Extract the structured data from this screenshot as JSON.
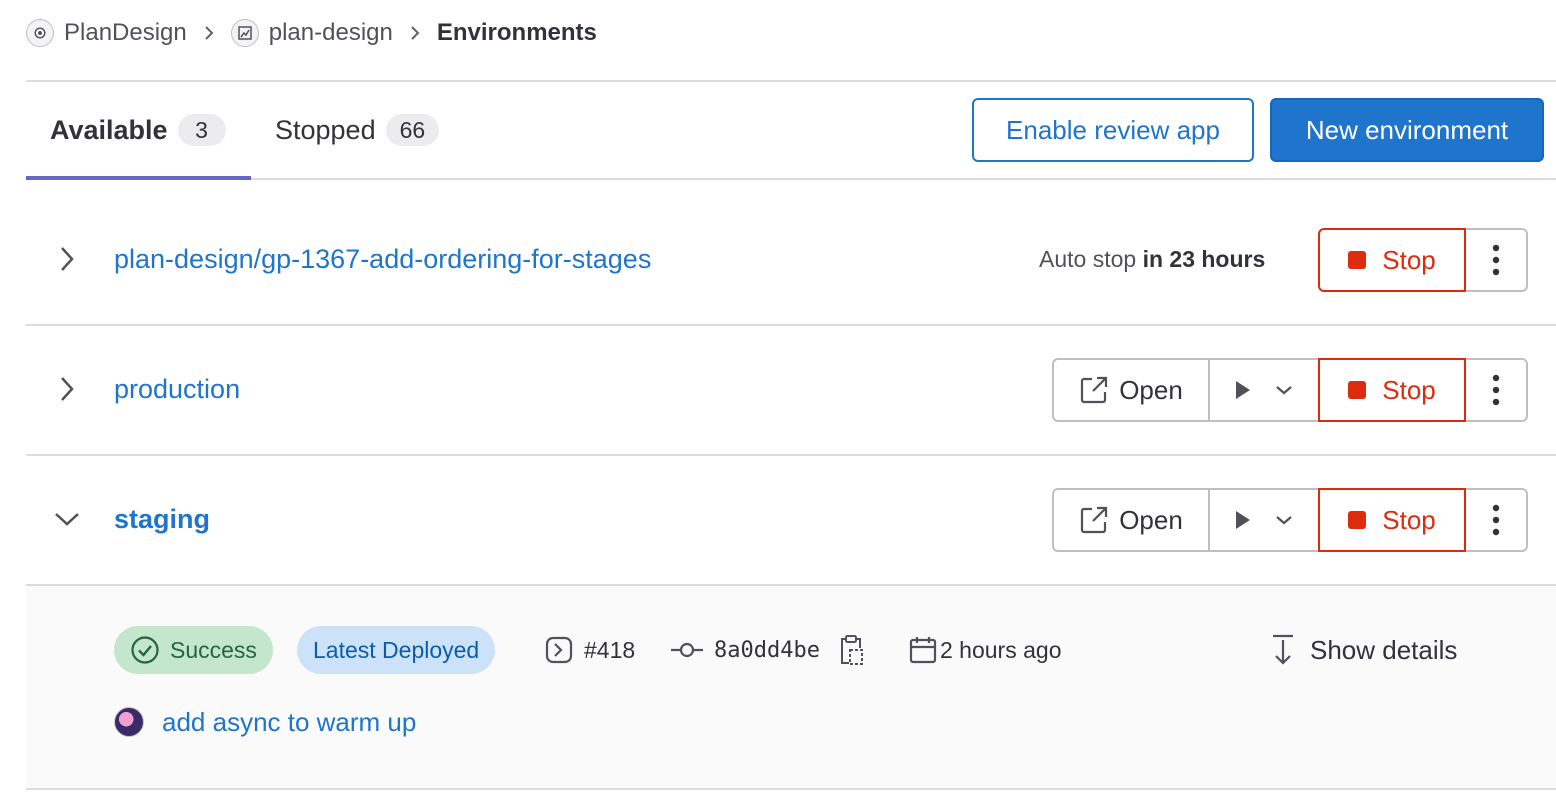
{
  "breadcrumb": {
    "group": "PlanDesign",
    "project": "plan-design",
    "current": "Environments"
  },
  "tabs": [
    {
      "label": "Available",
      "count": "3",
      "active": true
    },
    {
      "label": "Stopped",
      "count": "66",
      "active": false
    }
  ],
  "actions": {
    "enable_review_app": "Enable review app",
    "new_environment": "New environment"
  },
  "environments": [
    {
      "name": "plan-design/gp-1367-add-ordering-for-stages",
      "expanded": false,
      "auto_stop_prefix": "Auto stop",
      "auto_stop_value": "in 23 hours",
      "stop_label": "Stop"
    },
    {
      "name": "production",
      "expanded": false,
      "open_label": "Open",
      "stop_label": "Stop"
    },
    {
      "name": "staging",
      "expanded": true,
      "open_label": "Open",
      "stop_label": "Stop"
    }
  ],
  "deployment": {
    "status": "Success",
    "tag": "Latest Deployed",
    "pipeline": "#418",
    "commit_sha": "8a0dd4be",
    "time": "2 hours ago",
    "show_details": "Show details",
    "commit_title": "add async to warm up"
  },
  "colors": {
    "link": "#1f75cb",
    "danger": "#dd2b0e",
    "success_bg": "#c3e6cd",
    "info_bg": "#cbe2f9",
    "tab_indicator": "#6666c4"
  }
}
